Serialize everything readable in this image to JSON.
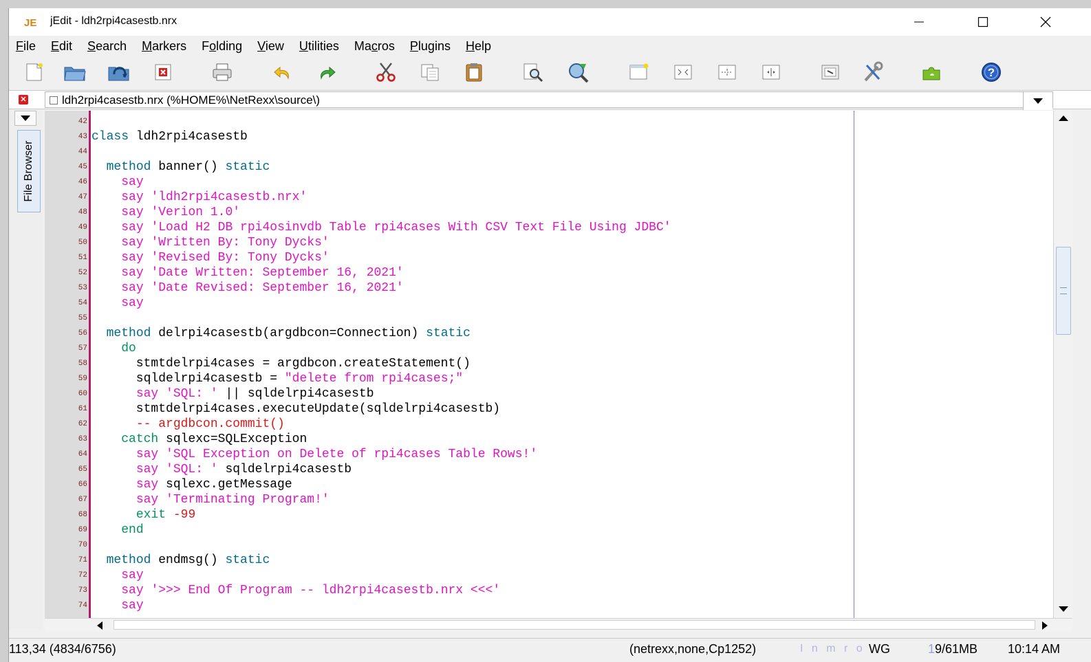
{
  "window": {
    "title": "jEdit - ldh2rpi4casestb.nrx",
    "colors": {
      "title_bg": "#ffffff",
      "gutter": "#dcdcdc",
      "gutter_line": "#b31b70",
      "wrap_guide": "#7d85d8",
      "keyword": "#006c8c",
      "string": "#e014c0",
      "comment": "#e01818"
    }
  },
  "menu": [
    {
      "pre": "",
      "mn": "F",
      "post": "ile"
    },
    {
      "pre": "",
      "mn": "E",
      "post": "dit"
    },
    {
      "pre": "",
      "mn": "S",
      "post": "earch"
    },
    {
      "pre": "",
      "mn": "M",
      "post": "arkers"
    },
    {
      "pre": "F",
      "mn": "o",
      "post": "lding"
    },
    {
      "pre": "",
      "mn": "V",
      "post": "iew"
    },
    {
      "pre": "",
      "mn": "U",
      "post": "tilities"
    },
    {
      "pre": "Ma",
      "mn": "c",
      "post": "ros"
    },
    {
      "pre": "",
      "mn": "P",
      "post": "lugins"
    },
    {
      "pre": "",
      "mn": "H",
      "post": "elp"
    }
  ],
  "toolbar_icons": [
    "new-file-icon",
    "open-file-icon",
    "reload-icon",
    "close-file-icon",
    "print-icon",
    "undo-icon",
    "redo-icon",
    "cut-icon",
    "copy-icon",
    "paste-icon",
    "find-icon",
    "find-next-icon",
    "new-view-icon",
    "split-horizontal-icon",
    "split-vertical-icon",
    "unsplit-icon",
    "buffer-options-icon",
    "global-options-icon",
    "plugin-manager-icon",
    "help-icon"
  ],
  "buffer": {
    "label": "ldh2rpi4casestb.nrx (%HOME%\\NetRexx\\source\\)"
  },
  "dock": {
    "tab_label": "File Browser"
  },
  "code_lines": [
    {
      "n": "42",
      "tokens": []
    },
    {
      "n": "43",
      "tokens": [
        {
          "t": "class",
          "c": "kw"
        },
        {
          "t": " ldh2rpi4casestb",
          "c": ""
        }
      ]
    },
    {
      "n": "44",
      "tokens": []
    },
    {
      "n": "45",
      "tokens": [
        {
          "t": "  ",
          "c": ""
        },
        {
          "t": "method",
          "c": "kw"
        },
        {
          "t": " banner() ",
          "c": ""
        },
        {
          "t": "static",
          "c": "kw"
        }
      ]
    },
    {
      "n": "46",
      "tokens": [
        {
          "t": "    ",
          "c": ""
        },
        {
          "t": "say",
          "c": "sy"
        }
      ]
    },
    {
      "n": "47",
      "tokens": [
        {
          "t": "    ",
          "c": ""
        },
        {
          "t": "say",
          "c": "sy"
        },
        {
          "t": " ",
          "c": ""
        },
        {
          "t": "'ldh2rpi4casestb.nrx'",
          "c": "st"
        }
      ]
    },
    {
      "n": "48",
      "tokens": [
        {
          "t": "    ",
          "c": ""
        },
        {
          "t": "say",
          "c": "sy"
        },
        {
          "t": " ",
          "c": ""
        },
        {
          "t": "'Verion 1.0'",
          "c": "st"
        }
      ]
    },
    {
      "n": "49",
      "tokens": [
        {
          "t": "    ",
          "c": ""
        },
        {
          "t": "say",
          "c": "sy"
        },
        {
          "t": " ",
          "c": ""
        },
        {
          "t": "'Load H2 DB rpi4osinvdb Table rpi4cases With CSV Text File Using JDBC'",
          "c": "st"
        }
      ]
    },
    {
      "n": "50",
      "tokens": [
        {
          "t": "    ",
          "c": ""
        },
        {
          "t": "say",
          "c": "sy"
        },
        {
          "t": " ",
          "c": ""
        },
        {
          "t": "'Written By: Tony Dycks'",
          "c": "st"
        }
      ]
    },
    {
      "n": "51",
      "tokens": [
        {
          "t": "    ",
          "c": ""
        },
        {
          "t": "say",
          "c": "sy"
        },
        {
          "t": " ",
          "c": ""
        },
        {
          "t": "'Revised By: Tony Dycks'",
          "c": "st"
        }
      ]
    },
    {
      "n": "52",
      "tokens": [
        {
          "t": "    ",
          "c": ""
        },
        {
          "t": "say",
          "c": "sy"
        },
        {
          "t": " ",
          "c": ""
        },
        {
          "t": "'Date Written: September 16, 2021'",
          "c": "st"
        }
      ]
    },
    {
      "n": "53",
      "tokens": [
        {
          "t": "    ",
          "c": ""
        },
        {
          "t": "say",
          "c": "sy"
        },
        {
          "t": " ",
          "c": ""
        },
        {
          "t": "'Date Revised: September 16, 2021'",
          "c": "st"
        }
      ]
    },
    {
      "n": "54",
      "tokens": [
        {
          "t": "    ",
          "c": ""
        },
        {
          "t": "say",
          "c": "sy"
        }
      ]
    },
    {
      "n": "55",
      "tokens": []
    },
    {
      "n": "56",
      "tokens": [
        {
          "t": "  ",
          "c": ""
        },
        {
          "t": "method",
          "c": "kw"
        },
        {
          "t": " delrpi4casestb(argdbcon=Connection) ",
          "c": ""
        },
        {
          "t": "static",
          "c": "kw"
        }
      ]
    },
    {
      "n": "57",
      "tokens": [
        {
          "t": "    ",
          "c": ""
        },
        {
          "t": "do",
          "c": "kg"
        }
      ]
    },
    {
      "n": "58",
      "tokens": [
        {
          "t": "      stmtdelrpi4cases = argdbcon.createStatement()",
          "c": ""
        }
      ]
    },
    {
      "n": "59",
      "tokens": [
        {
          "t": "      sqldelrpi4casestb = ",
          "c": ""
        },
        {
          "t": "\"delete from rpi4cases;\"",
          "c": "st"
        }
      ]
    },
    {
      "n": "60",
      "tokens": [
        {
          "t": "      ",
          "c": ""
        },
        {
          "t": "say",
          "c": "sy"
        },
        {
          "t": " ",
          "c": ""
        },
        {
          "t": "'SQL: '",
          "c": "st"
        },
        {
          "t": " || sqldelrpi4casestb",
          "c": ""
        }
      ]
    },
    {
      "n": "61",
      "tokens": [
        {
          "t": "      stmtdelrpi4cases.executeUpdate(sqldelrpi4casestb)",
          "c": ""
        }
      ]
    },
    {
      "n": "62",
      "tokens": [
        {
          "t": "      ",
          "c": ""
        },
        {
          "t": "-- argdbcon.commit()",
          "c": "cm"
        }
      ]
    },
    {
      "n": "63",
      "tokens": [
        {
          "t": "    ",
          "c": ""
        },
        {
          "t": "catch",
          "c": "kg"
        },
        {
          "t": " sqlexc=SQLException",
          "c": ""
        }
      ]
    },
    {
      "n": "64",
      "tokens": [
        {
          "t": "      ",
          "c": ""
        },
        {
          "t": "say",
          "c": "sy"
        },
        {
          "t": " ",
          "c": ""
        },
        {
          "t": "'SQL Exception on Delete of rpi4cases Table Rows!'",
          "c": "st"
        }
      ]
    },
    {
      "n": "65",
      "tokens": [
        {
          "t": "      ",
          "c": ""
        },
        {
          "t": "say",
          "c": "sy"
        },
        {
          "t": " ",
          "c": ""
        },
        {
          "t": "'SQL: '",
          "c": "st"
        },
        {
          "t": " sqldelrpi4casestb",
          "c": ""
        }
      ]
    },
    {
      "n": "66",
      "tokens": [
        {
          "t": "      ",
          "c": ""
        },
        {
          "t": "say",
          "c": "sy"
        },
        {
          "t": " sqlexc.getMessage",
          "c": ""
        }
      ]
    },
    {
      "n": "67",
      "tokens": [
        {
          "t": "      ",
          "c": ""
        },
        {
          "t": "say",
          "c": "sy"
        },
        {
          "t": " ",
          "c": ""
        },
        {
          "t": "'Terminating Program!'",
          "c": "st"
        }
      ]
    },
    {
      "n": "68",
      "tokens": [
        {
          "t": "      ",
          "c": ""
        },
        {
          "t": "exit",
          "c": "kg"
        },
        {
          "t": " ",
          "c": ""
        },
        {
          "t": "-99",
          "c": "nm"
        }
      ]
    },
    {
      "n": "69",
      "tokens": [
        {
          "t": "    ",
          "c": ""
        },
        {
          "t": "end",
          "c": "kg"
        }
      ]
    },
    {
      "n": "70",
      "tokens": []
    },
    {
      "n": "71",
      "tokens": [
        {
          "t": "  ",
          "c": ""
        },
        {
          "t": "method",
          "c": "kw"
        },
        {
          "t": " endmsg() ",
          "c": ""
        },
        {
          "t": "static",
          "c": "kw"
        }
      ]
    },
    {
      "n": "72",
      "tokens": [
        {
          "t": "    ",
          "c": ""
        },
        {
          "t": "say",
          "c": "sy"
        }
      ]
    },
    {
      "n": "73",
      "tokens": [
        {
          "t": "    ",
          "c": ""
        },
        {
          "t": "say",
          "c": "sy"
        },
        {
          "t": " ",
          "c": ""
        },
        {
          "t": "'>>> End Of Program -- ldh2rpi4casestb.nrx <<<'",
          "c": "st"
        }
      ]
    },
    {
      "n": "74",
      "tokens": [
        {
          "t": "    ",
          "c": ""
        },
        {
          "t": "say",
          "c": "sy"
        }
      ]
    }
  ],
  "status": {
    "caret": "113,34 (4834/6756)",
    "mode": "(netrexx,none,Cp1252)",
    "flags": "I n m r o",
    "wg": "WG",
    "mem_prefix": "1",
    "mem": "9/61MB",
    "time": "10:14 AM"
  }
}
